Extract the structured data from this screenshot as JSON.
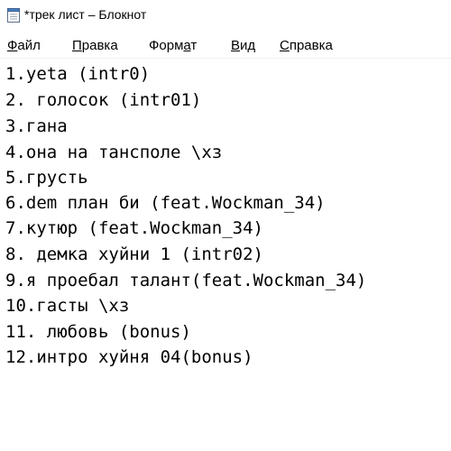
{
  "window": {
    "title": "*трек лист – Блокнот",
    "icon": "notepad-icon"
  },
  "menu": {
    "file": {
      "label_ul": "Ф",
      "label_rest": "айл"
    },
    "edit": {
      "label_ul": "П",
      "label_rest": "равка"
    },
    "format": {
      "label_pre": "Форм",
      "label_ul": "а",
      "label_rest": "т"
    },
    "view": {
      "label_ul": "В",
      "label_rest": "ид"
    },
    "help": {
      "label_ul": "С",
      "label_rest": "правка"
    }
  },
  "editor": {
    "lines": [
      "1.yeta (intr0)",
      "2. голосок (intr01)",
      "3.гана",
      "4.она на тансполе \\хз",
      "5.грусть",
      "6.dem план би (feat.Wockman_34)",
      "7.кутюр (feat.Wockman_34)",
      "8. демка хуйни 1 (intr02)",
      "9.я проебал талант(feat.Wockman_34)",
      "10.гасты \\хз",
      "11. любовь (bonus)",
      "12.интро хуйня 04(bonus)"
    ]
  }
}
